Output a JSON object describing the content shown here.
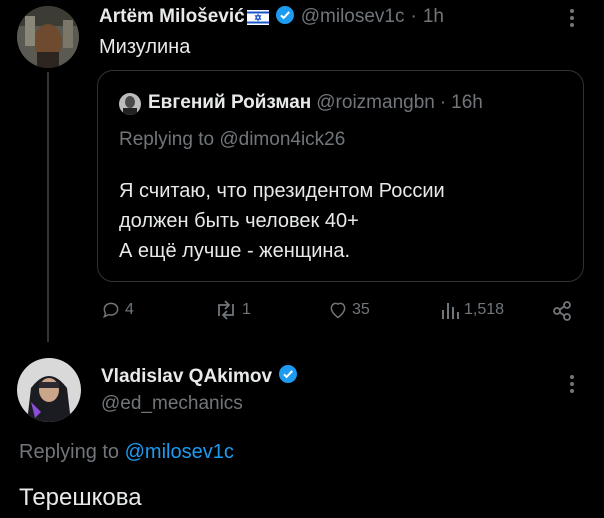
{
  "tweet1": {
    "author_name": "Artëm Milošević",
    "handle": "@milosev1c",
    "time": "1h",
    "sep": "·",
    "text": "Мизулина"
  },
  "quote": {
    "author_name": "Евгений Ройзман",
    "handle": "@roizmangbn",
    "time": "16h",
    "sep": "·",
    "replying_prefix": "Replying to",
    "replying_handle": "@dimon4ick26",
    "lines": [
      "Я считаю, что президентом России",
      "должен быть человек 40+",
      "А ещё лучше - женщина."
    ]
  },
  "actions": {
    "replies": "4",
    "reposts": "1",
    "likes": "35",
    "views": "1,518"
  },
  "tweet2": {
    "author_name": "Vladislav QAkimov",
    "handle": "@ed_mechanics",
    "replying_prefix": "Replying to",
    "replying_handle": "@milosev1c",
    "text": "Терешкова"
  },
  "colors": {
    "background": "#000000",
    "text": "#e7e9ea",
    "muted": "#71767b",
    "link": "#1d9bf0",
    "verified": "#1d9bf0",
    "border": "#2f3336"
  },
  "icons": [
    "israel-flag-icon",
    "verified-badge-icon",
    "more-icon",
    "reply-icon",
    "repost-icon",
    "like-icon",
    "views-icon",
    "share-icon"
  ]
}
